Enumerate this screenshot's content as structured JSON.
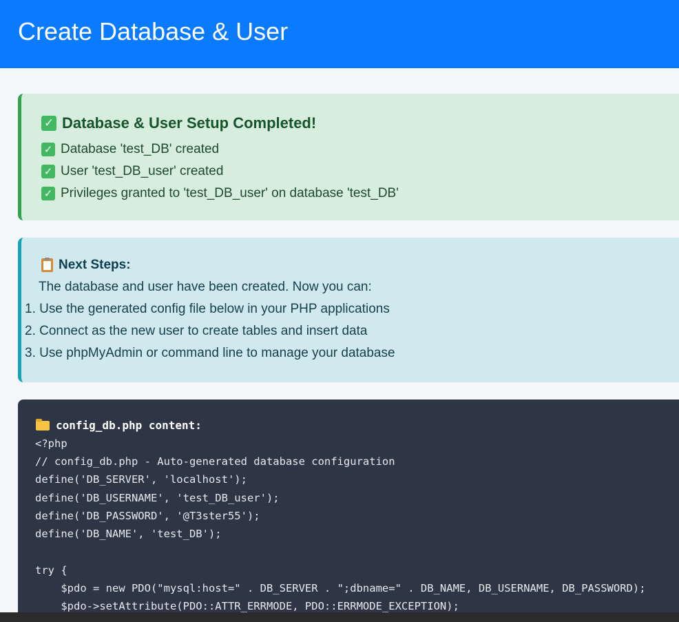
{
  "header": {
    "title": "Create Database & User"
  },
  "success": {
    "title": "Database & User Setup Completed!",
    "items": [
      "Database 'test_DB' created",
      "User 'test_DB_user' created",
      "Privileges granted to 'test_DB_user' on database 'test_DB'"
    ],
    "check_icon": "check-mark-button"
  },
  "info": {
    "title": "Next Steps:",
    "intro": "The database and user have been created. Now you can:",
    "steps": [
      "1. Use the generated config file below in your PHP applications",
      "2. Connect as the new user to create tables and insert data",
      "3. Use phpMyAdmin or command line to manage your database"
    ],
    "icon": "clipboard-icon"
  },
  "code": {
    "title": "config_db.php content:",
    "icon": "folder-icon",
    "lines": [
      "<?php",
      "// config_db.php - Auto-generated database configuration",
      "define('DB_SERVER', 'localhost');",
      "define('DB_USERNAME', 'test_DB_user');",
      "define('DB_PASSWORD', '@T3ster55');",
      "define('DB_NAME', 'test_DB');",
      "",
      "try {",
      "    $pdo = new PDO(\"mysql:host=\" . DB_SERVER . \";dbname=\" . DB_NAME, DB_USERNAME, DB_PASSWORD);",
      "    $pdo->setAttribute(PDO::ATTR_ERRMODE, PDO::ERRMODE_EXCEPTION);"
    ]
  },
  "colors": {
    "header_bg": "#0a7bff",
    "success_bg": "#d7edde",
    "success_border": "#2ea44f",
    "info_bg": "#d0e9ee",
    "info_border": "#17a2b8",
    "code_bg": "#2e3646"
  }
}
